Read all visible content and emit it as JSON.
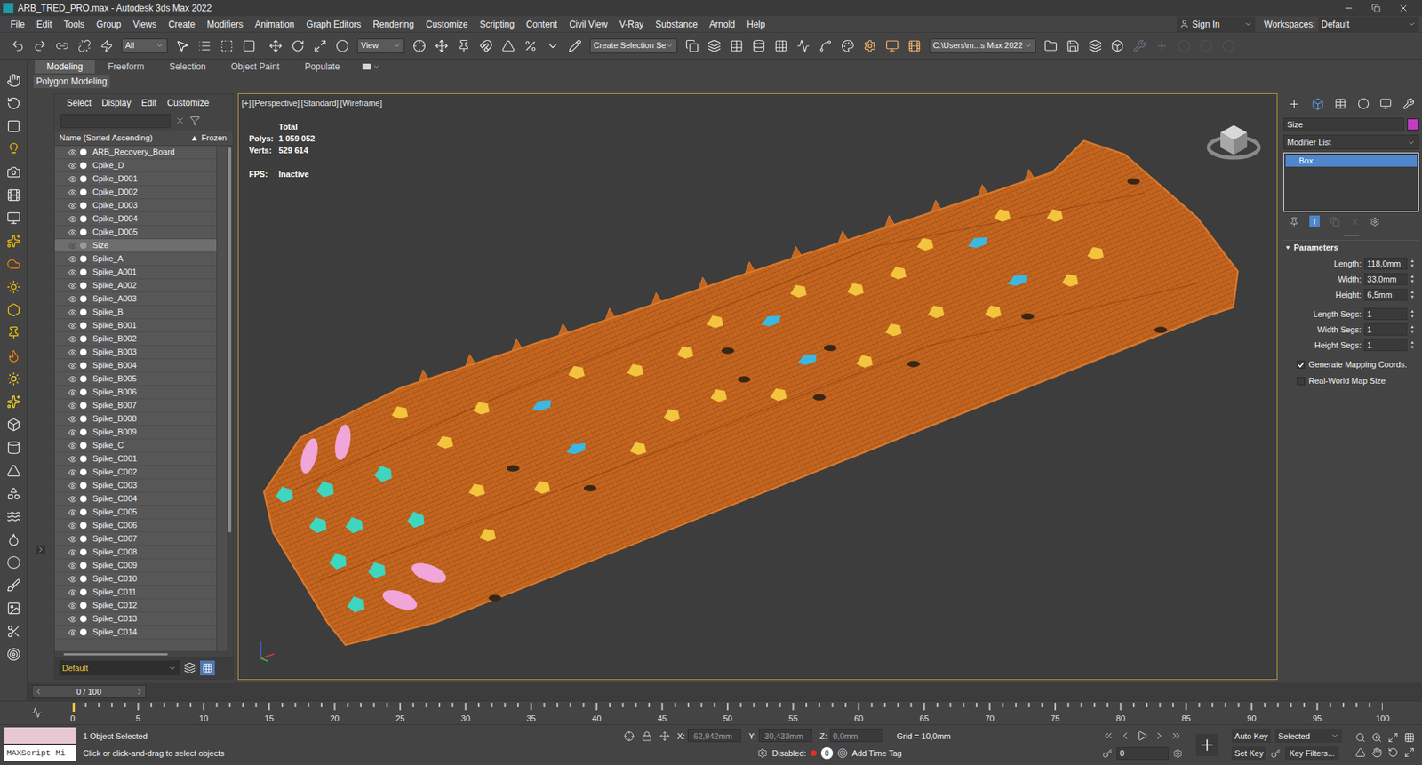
{
  "window": {
    "title": "ARB_TRED_PRO.max - Autodesk 3ds Max 2022"
  },
  "menu": [
    "File",
    "Edit",
    "Tools",
    "Group",
    "Views",
    "Create",
    "Modifiers",
    "Animation",
    "Graph Editors",
    "Rendering",
    "Customize",
    "Scripting",
    "Content",
    "Civil View",
    "V-Ray",
    "Substance",
    "Arnold",
    "Help"
  ],
  "account": {
    "sign_in": "Sign In",
    "workspaces_label": "Workspaces:",
    "workspace": "Default"
  },
  "toolbar": {
    "selection_filter": "All",
    "reference_coord": "View",
    "named_selection": "Create Selection Se",
    "project_path": "C:\\Users\\m...s Max 2022"
  },
  "ribbon": {
    "tabs": [
      {
        "label": "Modeling",
        "selected": true
      },
      {
        "label": "Freeform",
        "selected": false
      },
      {
        "label": "Selection",
        "selected": false
      },
      {
        "label": "Object Paint",
        "selected": false
      },
      {
        "label": "Populate",
        "selected": false
      }
    ],
    "panel": "Polygon Modeling"
  },
  "scene_explorer": {
    "menu": [
      "Select",
      "Display",
      "Edit",
      "Customize"
    ],
    "column_name": "Name (Sorted Ascending)",
    "sort_glyph": "▲",
    "column_frozen": "Frozen",
    "items": [
      {
        "name": "ARB_Recovery_Board",
        "visible": true,
        "selected": false
      },
      {
        "name": "Cpike_D",
        "visible": true,
        "selected": false
      },
      {
        "name": "Cpike_D001",
        "visible": true,
        "selected": false
      },
      {
        "name": "Cpike_D002",
        "visible": true,
        "selected": false
      },
      {
        "name": "Cpike_D003",
        "visible": true,
        "selected": false
      },
      {
        "name": "Cpike_D004",
        "visible": true,
        "selected": false
      },
      {
        "name": "Cpike_D005",
        "visible": true,
        "selected": false
      },
      {
        "name": "Size",
        "visible": false,
        "selected": true
      },
      {
        "name": "Spike_A",
        "visible": true,
        "selected": false
      },
      {
        "name": "Spike_A001",
        "visible": true,
        "selected": false
      },
      {
        "name": "Spike_A002",
        "visible": true,
        "selected": false
      },
      {
        "name": "Spike_A003",
        "visible": true,
        "selected": false
      },
      {
        "name": "Spike_B",
        "visible": true,
        "selected": false
      },
      {
        "name": "Spike_B001",
        "visible": true,
        "selected": false
      },
      {
        "name": "Spike_B002",
        "visible": true,
        "selected": false
      },
      {
        "name": "Spike_B003",
        "visible": true,
        "selected": false
      },
      {
        "name": "Spike_B004",
        "visible": true,
        "selected": false
      },
      {
        "name": "Spike_B005",
        "visible": true,
        "selected": false
      },
      {
        "name": "Spike_B006",
        "visible": true,
        "selected": false
      },
      {
        "name": "Spike_B007",
        "visible": true,
        "selected": false
      },
      {
        "name": "Spike_B008",
        "visible": true,
        "selected": false
      },
      {
        "name": "Spike_B009",
        "visible": true,
        "selected": false
      },
      {
        "name": "Spike_C",
        "visible": true,
        "selected": false
      },
      {
        "name": "Spike_C001",
        "visible": true,
        "selected": false
      },
      {
        "name": "Spike_C002",
        "visible": true,
        "selected": false
      },
      {
        "name": "Spike_C003",
        "visible": true,
        "selected": false
      },
      {
        "name": "Spike_C004",
        "visible": true,
        "selected": false
      },
      {
        "name": "Spike_C005",
        "visible": true,
        "selected": false
      },
      {
        "name": "Spike_C006",
        "visible": true,
        "selected": false
      },
      {
        "name": "Spike_C007",
        "visible": true,
        "selected": false
      },
      {
        "name": "Spike_C008",
        "visible": true,
        "selected": false
      },
      {
        "name": "Spike_C009",
        "visible": true,
        "selected": false
      },
      {
        "name": "Spike_C010",
        "visible": true,
        "selected": false
      },
      {
        "name": "Spike_C011",
        "visible": true,
        "selected": false
      },
      {
        "name": "Spike_C012",
        "visible": true,
        "selected": false
      },
      {
        "name": "Spike_C013",
        "visible": true,
        "selected": false
      },
      {
        "name": "Spike_C014",
        "visible": true,
        "selected": false
      }
    ],
    "layer": "Default"
  },
  "viewport": {
    "labels": [
      "[+]",
      "[Perspective]",
      "[Standard]",
      "[Wireframe]"
    ],
    "stats_heading": "Total",
    "stats": [
      {
        "label": "Polys:",
        "value": "1 059 052"
      },
      {
        "label": "Verts:",
        "value": "529 614"
      }
    ],
    "fps_label": "FPS:",
    "fps": "Inactive"
  },
  "command_panel": {
    "object_name": "Size",
    "object_color": "#c23bc4",
    "modifier_list": "Modifier List",
    "stack": [
      {
        "label": "Box",
        "selected": true
      }
    ],
    "rollout": "Parameters",
    "params": [
      {
        "label": "Length:",
        "value": "118,0mm"
      },
      {
        "label": "Width:",
        "value": "33,0mm"
      },
      {
        "label": "Height:",
        "value": "6,5mm"
      }
    ],
    "segs": [
      {
        "label": "Length Segs:",
        "value": "1"
      },
      {
        "label": "Width Segs:",
        "value": "1"
      },
      {
        "label": "Height Segs:",
        "value": "1"
      }
    ],
    "checks": [
      {
        "label": "Generate Mapping Coords.",
        "checked": true
      },
      {
        "label": "Real-World Map Size",
        "checked": false
      }
    ]
  },
  "time_slider": {
    "label": "0 / 100",
    "level": 0
  },
  "track": {
    "ticks": [
      "0",
      "5",
      "10",
      "15",
      "20",
      "25",
      "30",
      "35",
      "40",
      "45",
      "50",
      "55",
      "60",
      "65",
      "70",
      "75",
      "80",
      "85",
      "90",
      "95",
      "100"
    ]
  },
  "status": {
    "maxscript": "MAXScript Mi",
    "selection": "1 Object Selected",
    "prompt": "Click or click-and-drag to select objects",
    "coords": [
      {
        "axis": "X:",
        "value": "-62,942mm"
      },
      {
        "axis": "Y:",
        "value": "-30,433mm"
      },
      {
        "axis": "Z:",
        "value": "0,0mm"
      }
    ],
    "grid": "Grid = 10,0mm",
    "disabled_label": "Disabled:",
    "toggle": "0",
    "time_tag": "Add Time Tag",
    "auto_key": "Auto Key",
    "key_mode": "Selected",
    "set_key": "Set Key",
    "key_filters": "Key Filters...",
    "frame": "0"
  }
}
